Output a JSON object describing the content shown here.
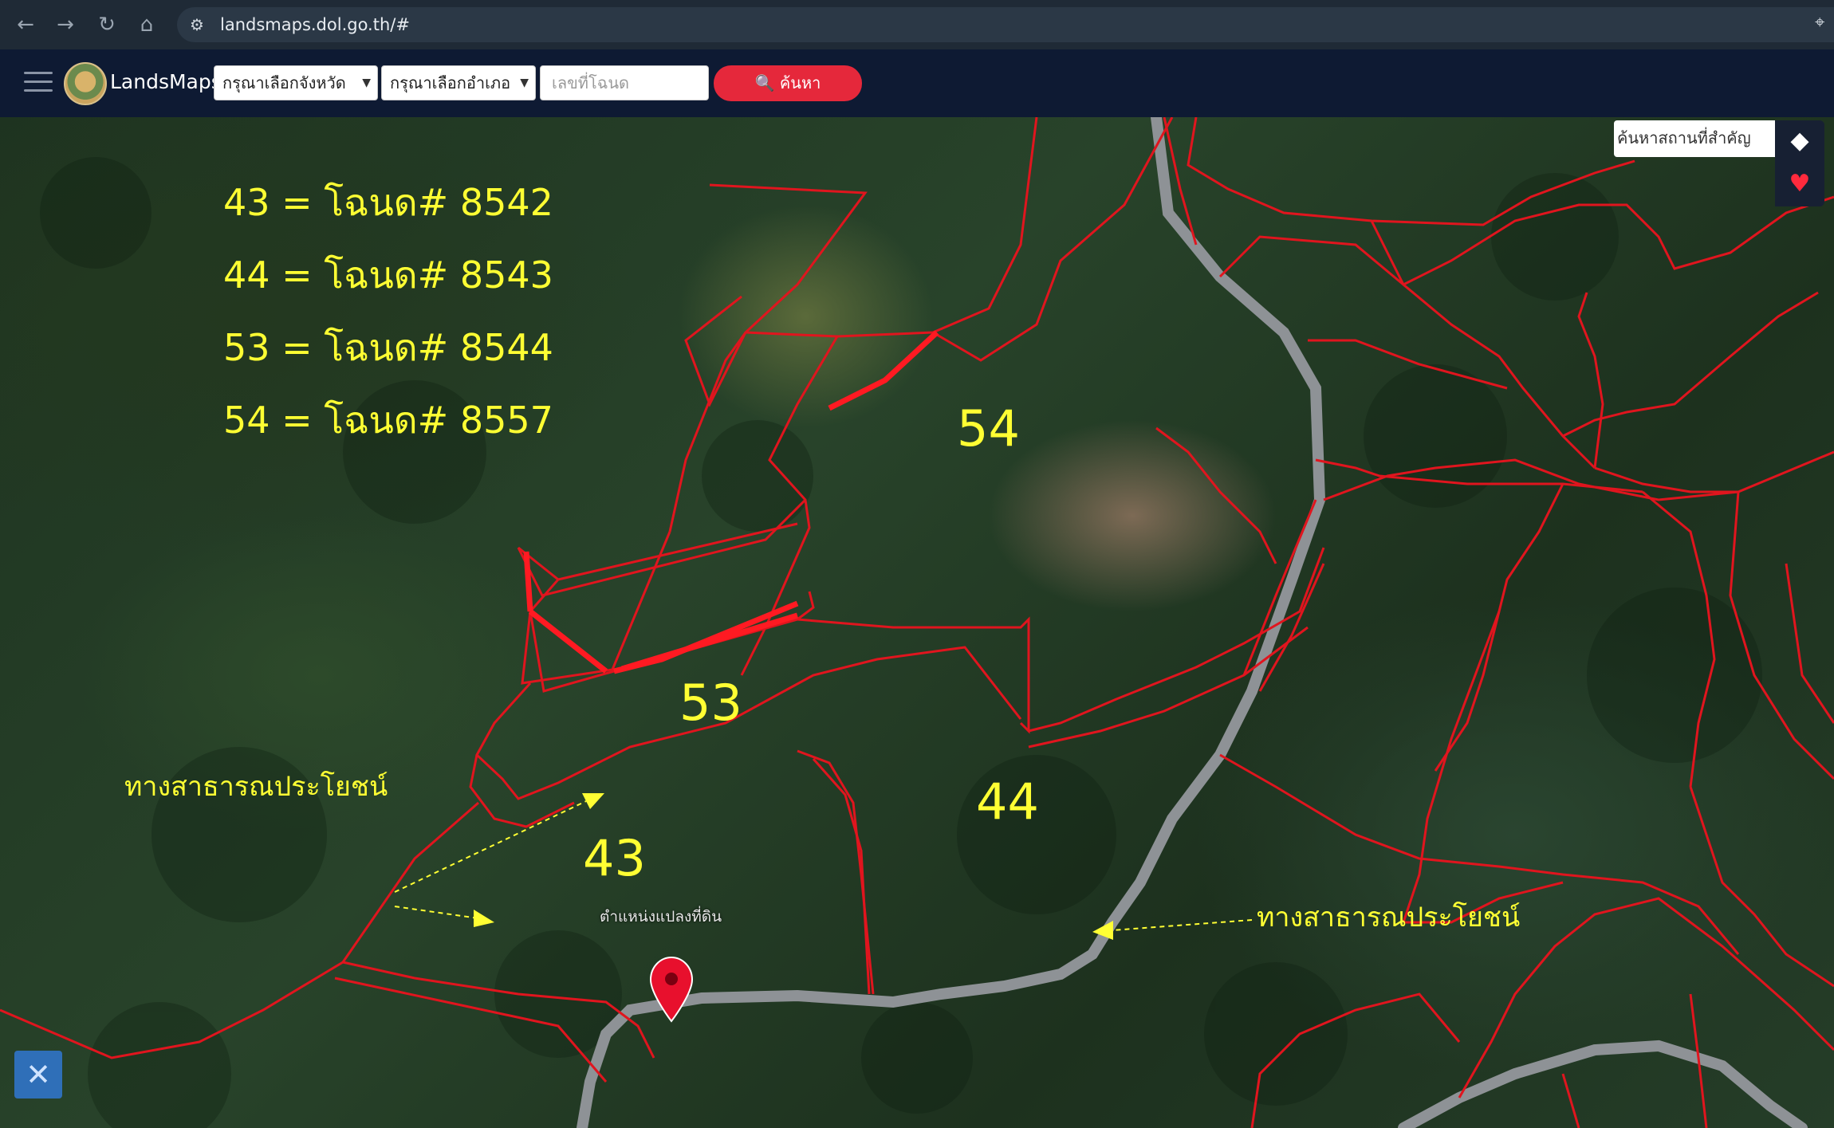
{
  "browser": {
    "url": "landsmaps.dol.go.th/#"
  },
  "header": {
    "brand": "LandsMaps",
    "province_select": "กรุณาเลือกจังหวัด",
    "district_select": "กรุณาเลือกอำเภอ",
    "deed_placeholder": "เลขที่โฉนด",
    "search_label": "ค้นหา"
  },
  "map": {
    "landmark_search_placeholder": "ค้นหาสถานที่สำคัญ",
    "legend": [
      "43 = โฉนด# 8542",
      "44 = โฉนด# 8543",
      "53 = โฉนด# 8544",
      "54 = โฉนด# 8557"
    ],
    "plots": {
      "p43": "43",
      "p44": "44",
      "p53": "53",
      "p54": "54"
    },
    "annotation_left": "ทางสาธารณประโยชน์",
    "annotation_right": "ทางสาธารณประโยชน์",
    "pin_label": "ตำแหน่งแปลงที่ดิน",
    "colors": {
      "parcel_line": "#e0151e",
      "annotation": "#ffff33",
      "pin": "#e8102d",
      "road": "#8e9296"
    }
  }
}
